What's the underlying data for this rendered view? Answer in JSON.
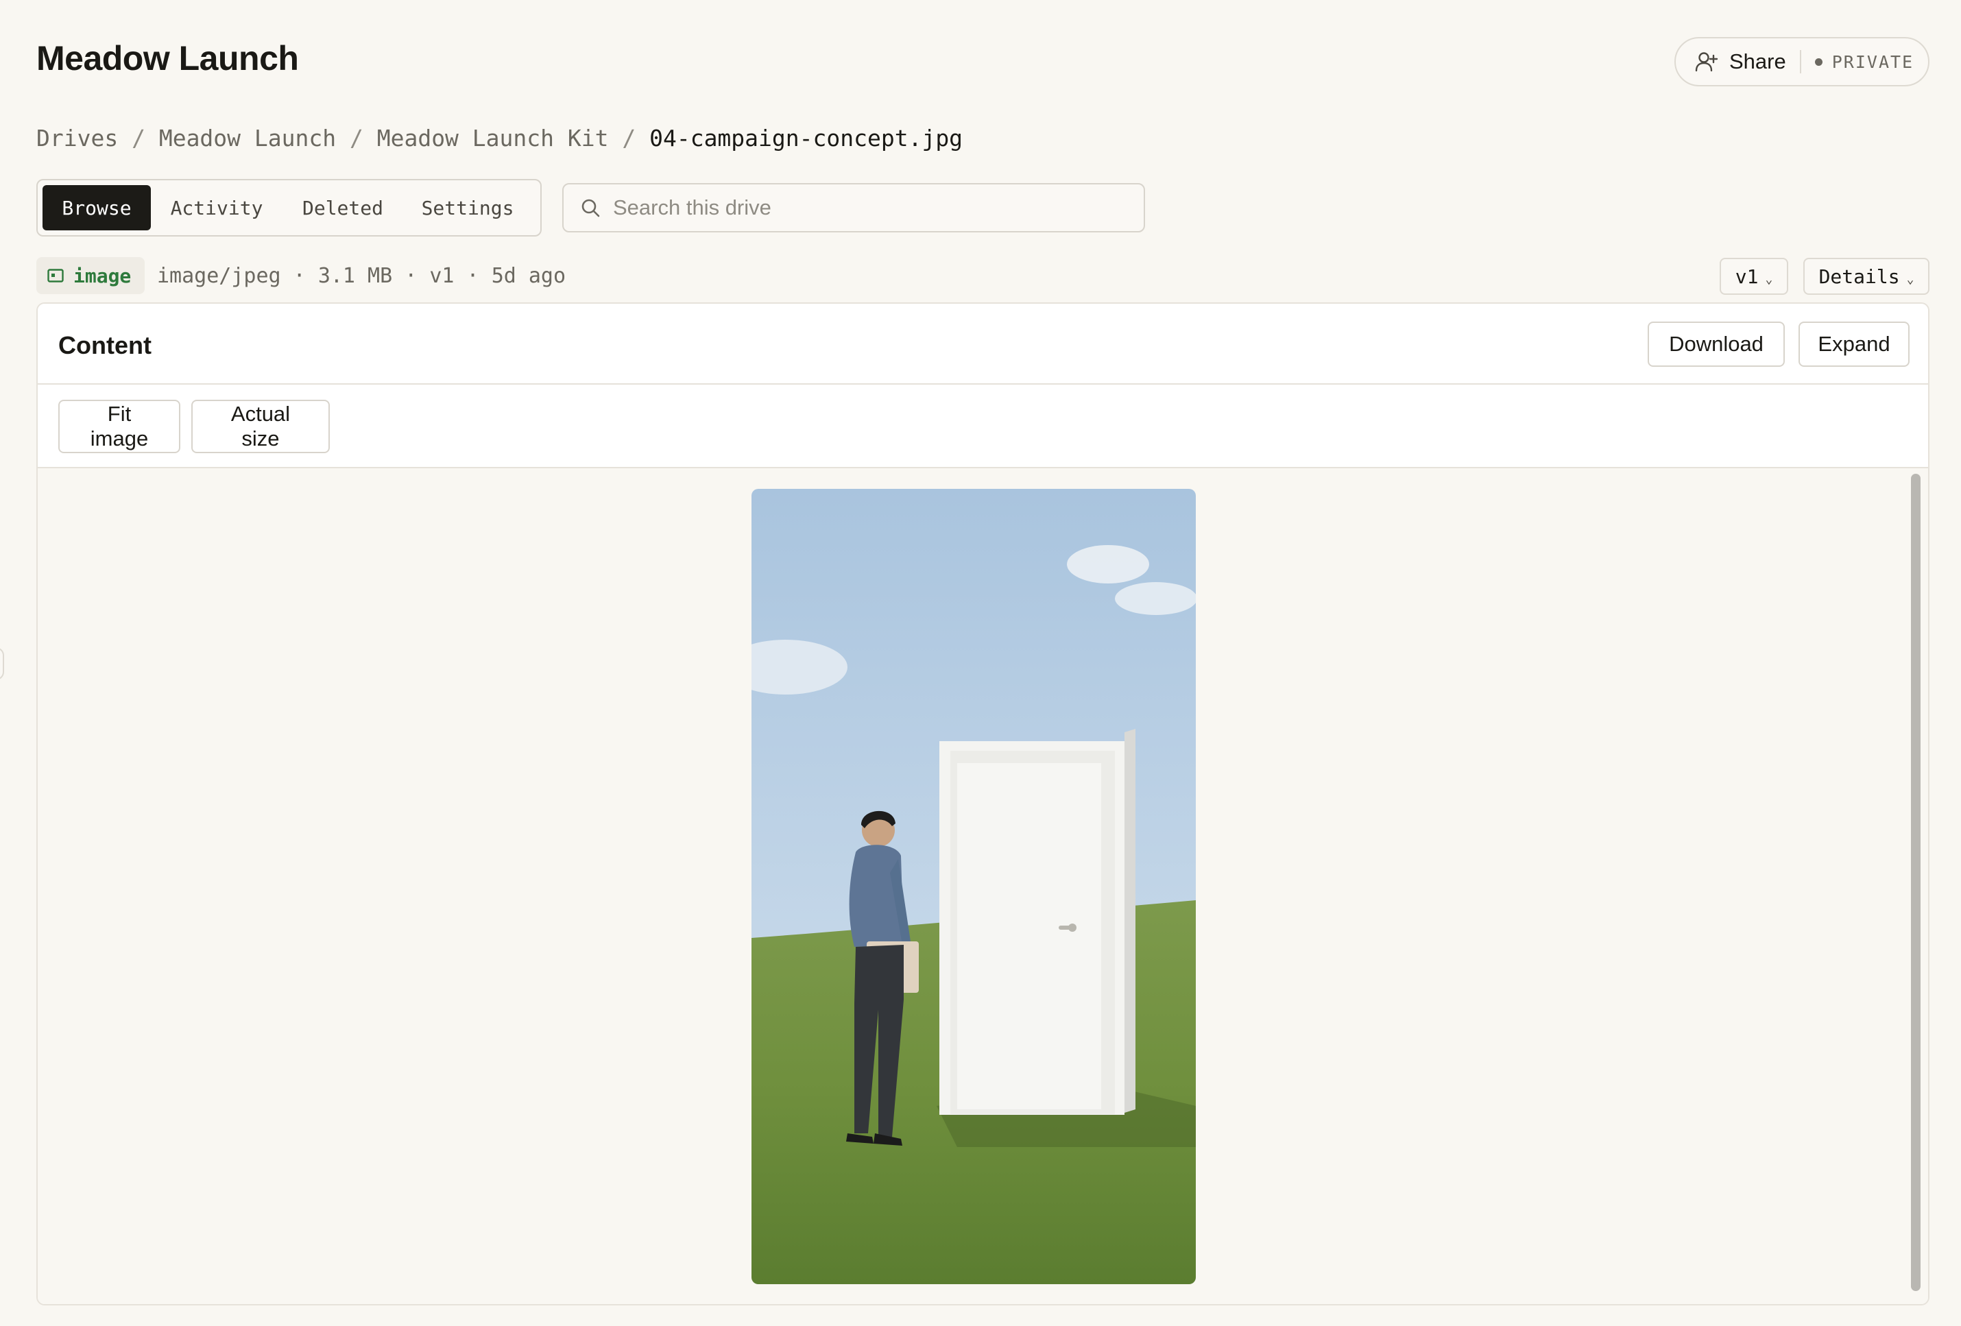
{
  "header": {
    "title": "Meadow Launch",
    "share_label": "Share",
    "privacy_label": "PRIVATE"
  },
  "breadcrumb": {
    "items": [
      "Drives",
      "Meadow Launch",
      "Meadow Launch Kit"
    ],
    "separator": " / ",
    "current": "04-campaign-concept.jpg"
  },
  "tabs": [
    {
      "label": "Browse",
      "active": true
    },
    {
      "label": "Activity",
      "active": false
    },
    {
      "label": "Deleted",
      "active": false
    },
    {
      "label": "Settings",
      "active": false
    }
  ],
  "search": {
    "placeholder": "Search this drive",
    "value": ""
  },
  "file": {
    "type_badge": "image",
    "mime": "image/jpeg",
    "size": "3.1 MB",
    "version": "v1",
    "age": "5d ago",
    "meta_separator": " · "
  },
  "controls": {
    "version_select": "v1",
    "details_select": "Details"
  },
  "content": {
    "title": "Content",
    "download_label": "Download",
    "expand_label": "Expand",
    "fit_label": "Fit image",
    "actual_size_label": "Actual size"
  },
  "icons": {
    "share": "user-plus-icon",
    "search": "search-icon",
    "image_type": "image-icon",
    "chevron": "chevron-down-icon"
  },
  "colors": {
    "background": "#f9f7f2",
    "active_tab": "#1c1b17",
    "badge_text": "#2e7a3c"
  }
}
